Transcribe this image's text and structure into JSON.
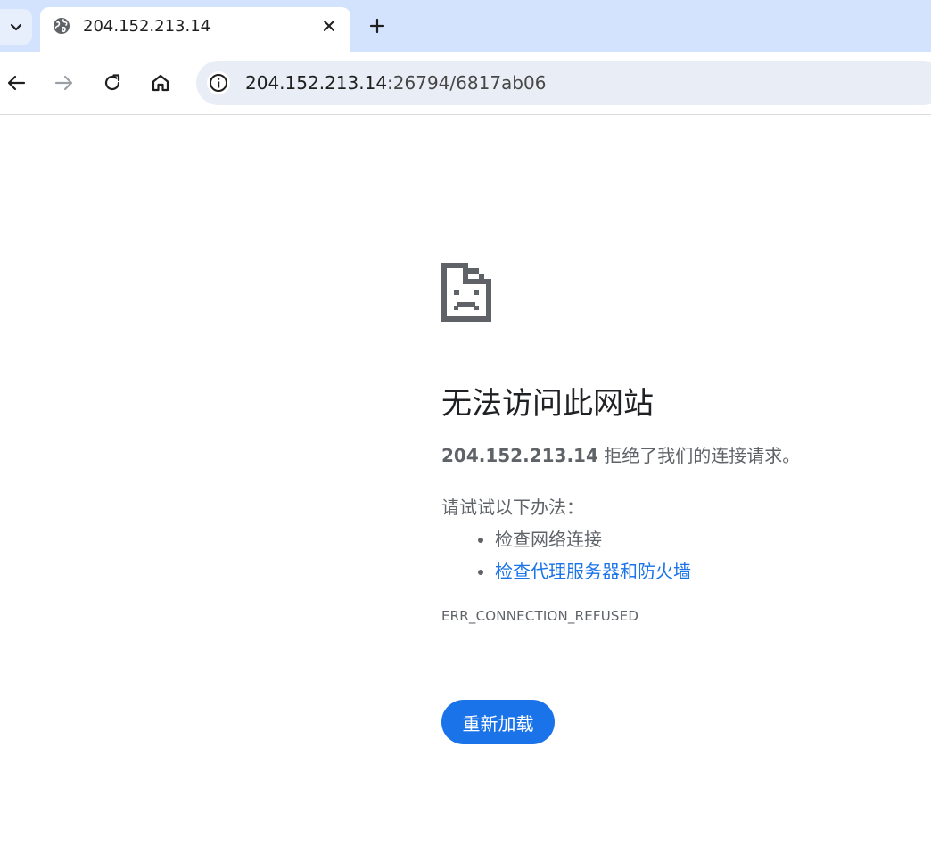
{
  "browser": {
    "tab": {
      "title": "204.152.213.14",
      "favicon": "globe-icon"
    },
    "omnibox": {
      "url_host": "204.152.213.14",
      "url_rest": ":26794/6817ab06"
    }
  },
  "error_page": {
    "heading": "无法访问此网站",
    "summary_host": "204.152.213.14",
    "summary_text": " 拒绝了我们的连接请求。",
    "suggestions_heading": "请试试以下办法：",
    "suggestions": [
      "检查网络连接",
      "检查代理服务器和防火墙"
    ],
    "error_code": "ERR_CONNECTION_REFUSED",
    "reload_label": "重新加载"
  },
  "colors": {
    "tabstrip_bg": "#d3e3fd",
    "omnibox_bg": "#e9eef6",
    "accent": "#1a73e8",
    "body_text": "#5f6368",
    "heading_text": "#202124"
  }
}
